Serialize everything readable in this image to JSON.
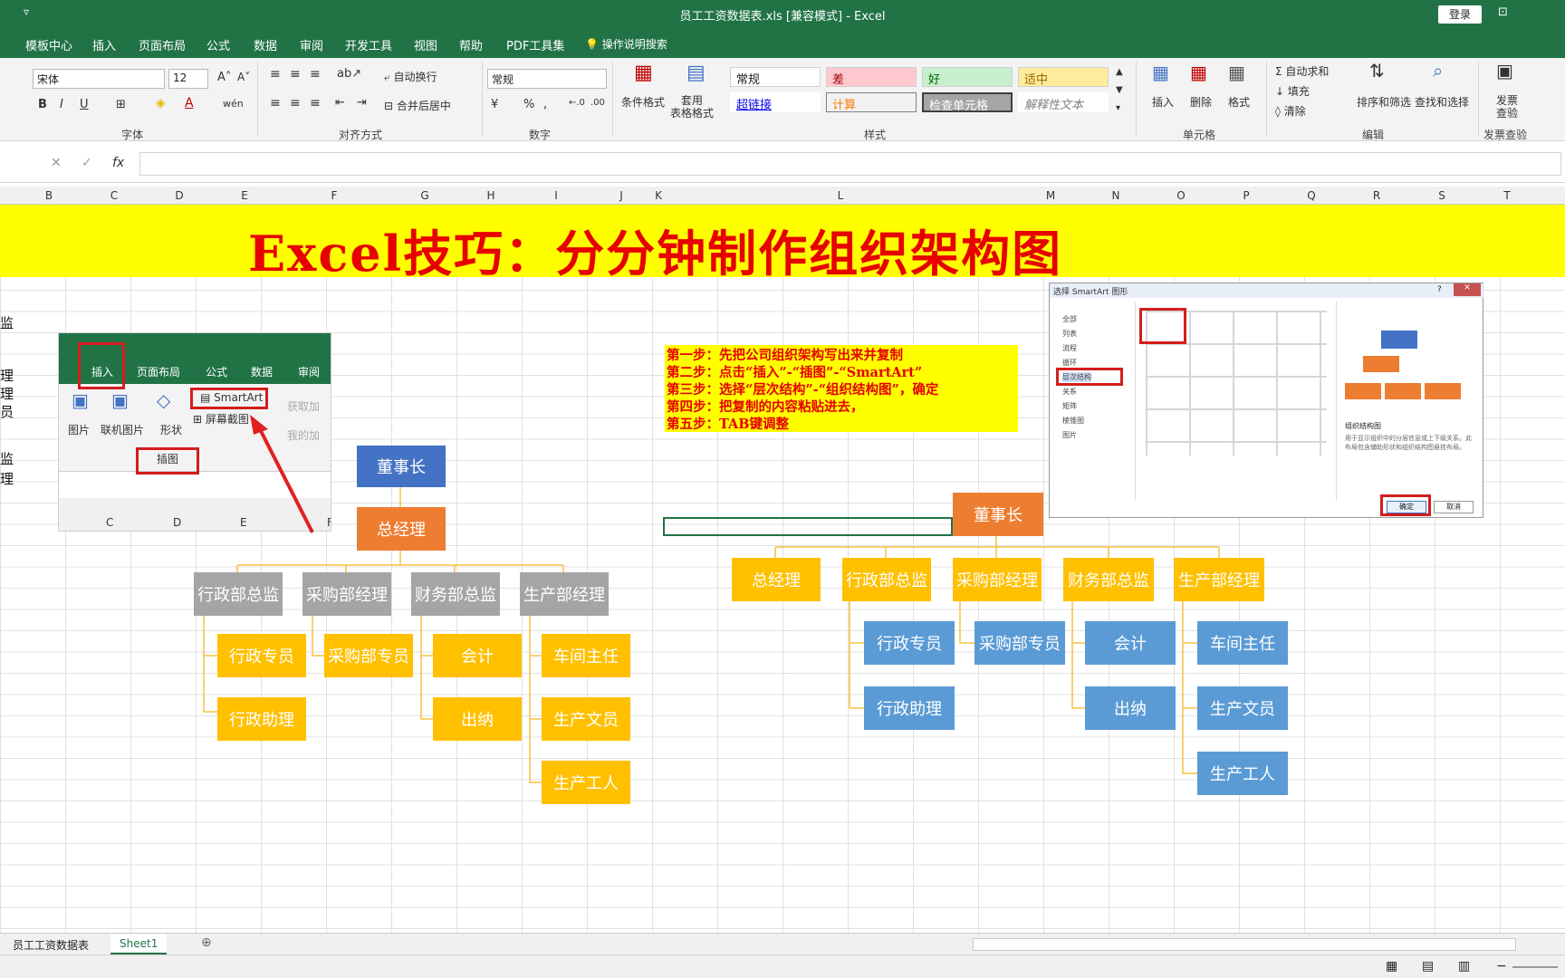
{
  "window": {
    "title": "员工工资数据表.xls [兼容模式] - Excel",
    "login": "登录"
  },
  "tabs": [
    "模板中心",
    "插入",
    "页面布局",
    "公式",
    "数据",
    "审阅",
    "开发工具",
    "视图",
    "帮助",
    "PDF工具集",
    "操作说明搜索"
  ],
  "ribbon": {
    "font_name": "宋体",
    "font_size": "12",
    "wrap_text": "自动换行",
    "merge_center": "合并后居中",
    "number_format": "常规",
    "cond_format": "条件格式",
    "table_format": "套用\n表格格式",
    "styles": {
      "normal": "常规",
      "bad": "差",
      "good": "好",
      "neutral": "适中",
      "hyperlink": "超链接",
      "calc": "计算",
      "check": "检查单元格",
      "explain": "解释性文本"
    },
    "insert": "插入",
    "delete": "删除",
    "format": "格式",
    "autosum": "自动求和",
    "fill": "填充",
    "clear": "清除",
    "sort": "排序和筛选",
    "find": "查找和选择",
    "invoice": "发票\n查验",
    "group_labels": {
      "font": "字体",
      "align": "对齐方式",
      "number": "数字",
      "styles": "样式",
      "cells": "单元格",
      "edit": "编辑",
      "invoice": "发票查验"
    }
  },
  "formula_bar": {
    "fx": "fx"
  },
  "columns": [
    "B",
    "C",
    "D",
    "E",
    "F",
    "G",
    "H",
    "I",
    "J",
    "K",
    "L",
    "M",
    "N",
    "O",
    "P",
    "Q",
    "R",
    "S",
    "T"
  ],
  "banner": {
    "title": "Excel技巧：分分钟制作组织架构图"
  },
  "left_cut_text": [
    "监",
    "理",
    "理",
    "员",
    "监",
    "理"
  ],
  "inset": {
    "tabs": [
      "插入",
      "页面布局",
      "公式",
      "数据",
      "审阅"
    ],
    "items": [
      "图片",
      "联机图片",
      "形状"
    ],
    "smartart": "SmartArt",
    "screenshot": "屏幕截图",
    "group": "插图",
    "get_addin": "获取加",
    "my_addin": "我的加",
    "cols": [
      "C",
      "D",
      "E",
      "F"
    ]
  },
  "org_left": {
    "chairman": "董事长",
    "gm": "总经理",
    "depts": [
      "行政部总监",
      "采购部经理",
      "财务部总监",
      "生产部经理"
    ],
    "admin": [
      "行政专员",
      "行政助理"
    ],
    "purchase": [
      "采购部专员"
    ],
    "finance": [
      "会计",
      "出纳"
    ],
    "production": [
      "车间主任",
      "生产文员",
      "生产工人"
    ]
  },
  "steps": [
    "第一步：先把公司组织架构写出来并复制",
    "第二步：点击“插入”-“插图”-“SmartArt”",
    "第三步：选择“层次结构”-“组织结构图”，确定",
    "第四步：把复制的内容粘贴进去，",
    "第五步：TAB键调整"
  ],
  "dialog": {
    "title": "选择 SmartArt 图形",
    "categories": [
      "全部",
      "列表",
      "流程",
      "循环",
      "层次结构",
      "关系",
      "矩阵",
      "棱锥图",
      "图片"
    ],
    "preview_name": "组织结构图",
    "preview_desc": "用于显示组织中的分层信息或上下级关系。此布局包含辅助形状和组织结构图悬挂布局。",
    "ok": "确定",
    "cancel": "取消"
  },
  "org_right": {
    "chairman": "董事长",
    "row": [
      "总经理",
      "行政部总监",
      "采购部经理",
      "财务部总监",
      "生产部经理"
    ],
    "admin": [
      "行政专员",
      "行政助理"
    ],
    "purchase": [
      "采购部专员"
    ],
    "finance": [
      "会计",
      "出纳"
    ],
    "production": [
      "车间主任",
      "生产文员",
      "生产工人"
    ]
  },
  "sheets": [
    "员工工资数据表",
    "Sheet1"
  ],
  "colors": {
    "excel_green": "#217346",
    "banner_yellow": "#ffff00",
    "banner_red": "#e60000",
    "head_blue": "#4472c4",
    "orange": "#ed7d31",
    "gray": "#a5a5a5",
    "yellow": "#ffc000",
    "light_blue": "#5b9bd5"
  }
}
